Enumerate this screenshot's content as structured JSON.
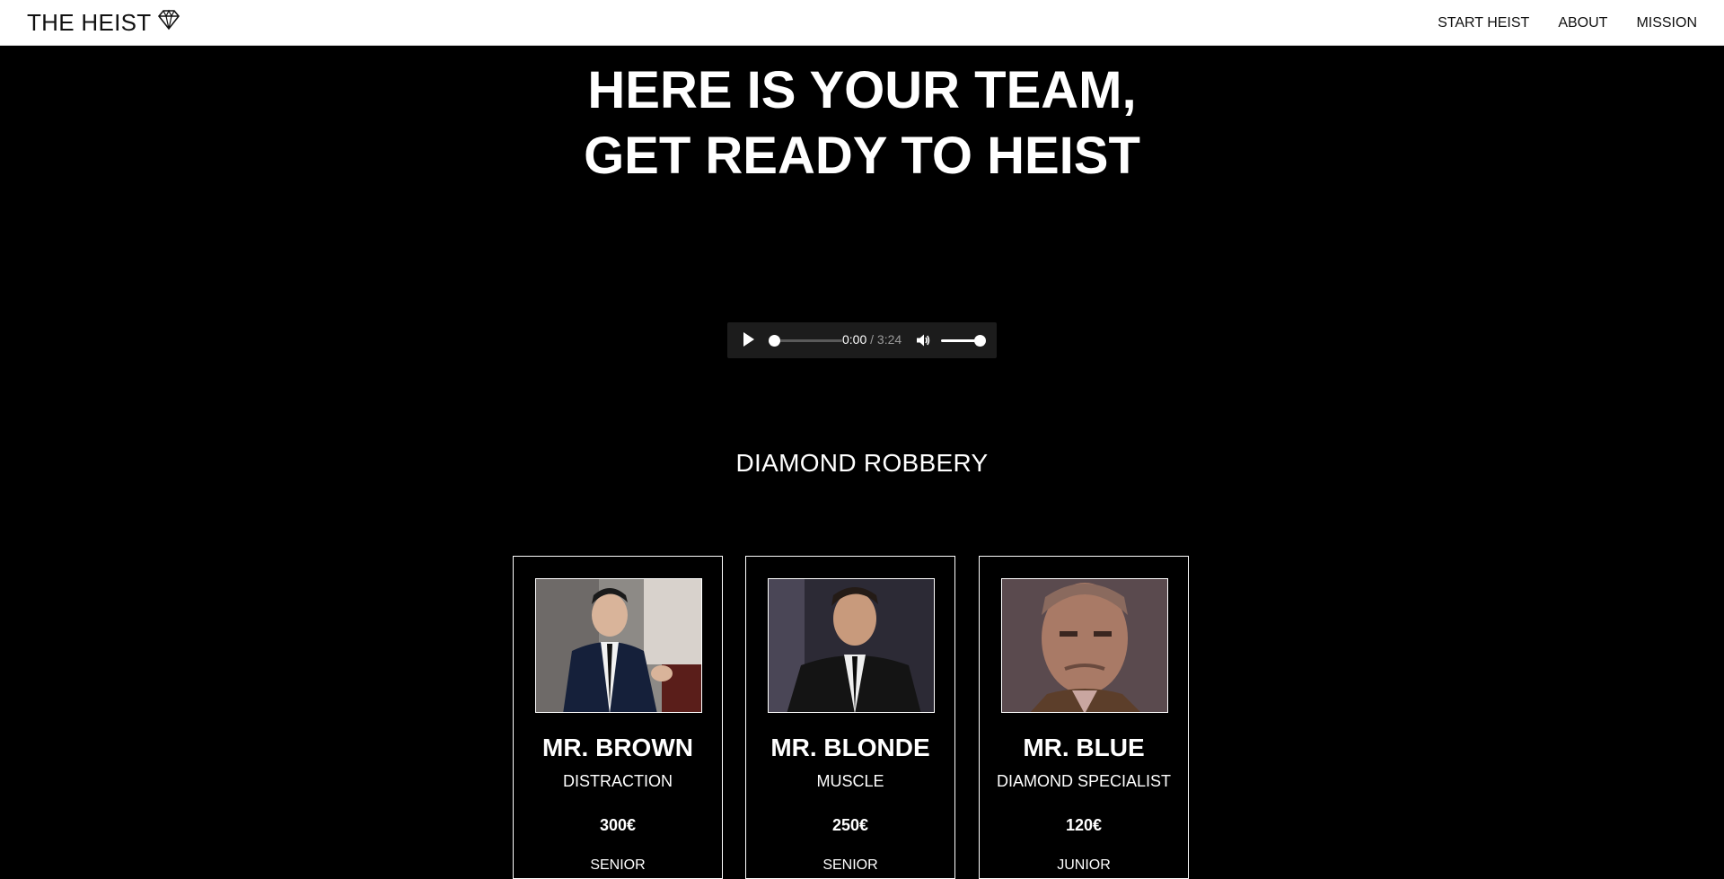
{
  "nav": {
    "brand": "THE HEIST",
    "brand_icon": "diamond-icon",
    "links": [
      "START HEIST",
      "ABOUT",
      "MISSION"
    ]
  },
  "hero": {
    "line1": "HERE IS YOUR TEAM,",
    "line2": "GET READY TO HEIST"
  },
  "audio": {
    "current_time": "0:00",
    "separator": " / ",
    "duration": "3:24",
    "progress": 0.0,
    "volume": 1.0,
    "play_icon": "play-icon",
    "volume_icon": "volume-icon"
  },
  "mission": {
    "title": "DIAMOND ROBBERY"
  },
  "team": [
    {
      "name": "MR. BROWN",
      "role": "DISTRACTION",
      "price": "300€",
      "level": "SENIOR"
    },
    {
      "name": "MR. BLONDE",
      "role": "MUSCLE",
      "price": "250€",
      "level": "SENIOR"
    },
    {
      "name": "MR. BLUE",
      "role": "DIAMOND SPECIALIST",
      "price": "120€",
      "level": "JUNIOR"
    }
  ],
  "colors": {
    "background": "#000000",
    "navbar": "#ffffff",
    "text": "#ffffff",
    "player": "#1c1c1c"
  }
}
